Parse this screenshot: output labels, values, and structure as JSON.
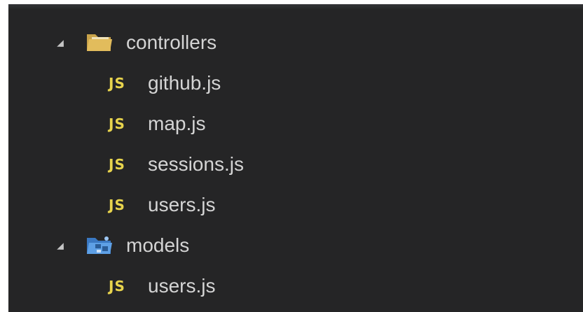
{
  "explorer": {
    "folders": [
      {
        "name": "controllers",
        "icon": "folder-open-icon",
        "expanded": true,
        "files": [
          {
            "name": "github.js",
            "badge": "JS"
          },
          {
            "name": "map.js",
            "badge": "JS"
          },
          {
            "name": "sessions.js",
            "badge": "JS"
          },
          {
            "name": "users.js",
            "badge": "JS"
          }
        ]
      },
      {
        "name": "models",
        "icon": "models-folder-icon",
        "expanded": true,
        "files": [
          {
            "name": "users.js",
            "badge": "JS"
          }
        ]
      }
    ]
  },
  "colors": {
    "background": "#252526",
    "text": "#d4d4d4",
    "js_badge": "#e8d44d",
    "folder": "#d9b454",
    "models_folder": "#4d8fd6"
  }
}
